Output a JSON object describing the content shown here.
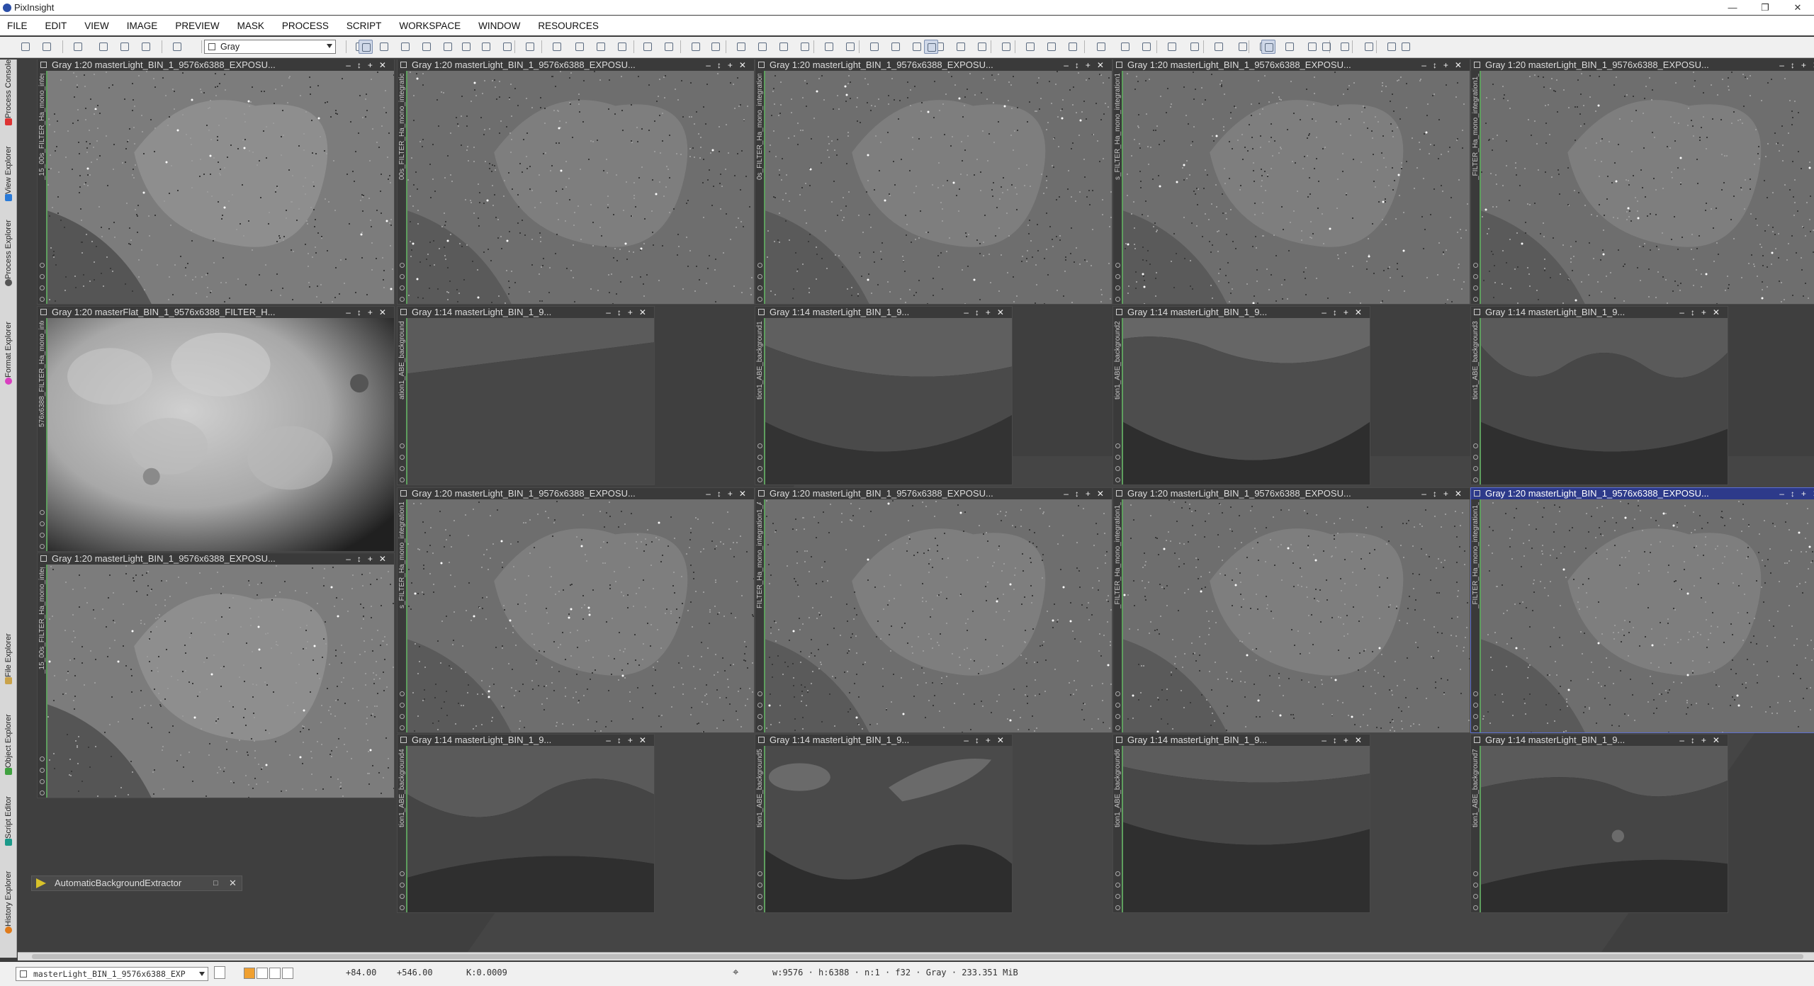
{
  "app": {
    "title": "PixInsight"
  },
  "menu": [
    "FILE",
    "EDIT",
    "VIEW",
    "IMAGE",
    "PREVIEW",
    "MASK",
    "PROCESS",
    "SCRIPT",
    "WORKSPACE",
    "WINDOW",
    "RESOURCES"
  ],
  "toolbar": {
    "view_selector": "Gray"
  },
  "left_tabs": [
    "Process Console",
    "View Explorer",
    "Process Explorer",
    "Format Explorer",
    "File Explorer",
    "Object Explorer",
    "Script Editor",
    "History Explorer"
  ],
  "windows": [
    {
      "title": "Gray 1:20 masterLight_BIN_1_9576x6388_EXPOSU...",
      "side": "_15_00s_FILTER_Ha_mono_integration1",
      "kind": "nebula",
      "active": false
    },
    {
      "title": "Gray 1:20 masterLight_BIN_1_9576x6388_EXPOSU...",
      "side": "00s_FILTER_Ha_mono_integration1_ABE",
      "kind": "nebula",
      "active": false
    },
    {
      "title": "Gray 1:20 masterLight_BIN_1_9576x6388_EXPOSU...",
      "side": "0s_FILTER_Ha_mono_integration1_ABE1",
      "kind": "nebula",
      "active": false
    },
    {
      "title": "Gray 1:20 masterLight_BIN_1_9576x6388_EXPOSU...",
      "side": "s_FILTER_Ha_mono_integration1_ABE2",
      "kind": "nebula",
      "active": false
    },
    {
      "title": "Gray 1:20 masterLight_BIN_1_9576x6388_EXPOSU...",
      "side": "_FILTER_Ha_mono_integration1_ABE3",
      "kind": "nebula",
      "active": false
    },
    {
      "title": "Gray 1:20 masterFlat_BIN_1_9576x6388_FILTER_H...",
      "side": "576x6388_FILTER_Ha_mono_integration",
      "kind": "flat",
      "active": false
    },
    {
      "title": "Gray 1:20 masterLight_BIN_1_9576x6388_EXPOSU...",
      "side": "_15_00s_FILTER_Ha_mono_integration",
      "kind": "nebula",
      "active": false
    },
    {
      "title": "Gray 1:14 masterLight_BIN_1_9...",
      "side": "ation1_ABE_background",
      "kind": "bg",
      "active": false
    },
    {
      "title": "Gray 1:14 masterLight_BIN_1_9...",
      "side": "tion1_ABE_background1",
      "kind": "bg",
      "active": false
    },
    {
      "title": "Gray 1:14 masterLight_BIN_1_9...",
      "side": "tion1_ABE_background2",
      "kind": "bg",
      "active": false
    },
    {
      "title": "Gray 1:14 masterLight_BIN_1_9...",
      "side": "tion1_ABE_background3",
      "kind": "bg",
      "active": false
    },
    {
      "title": "Gray 1:20 masterLight_BIN_1_9576x6388_EXPOSU...",
      "side": "s_FILTER_Ha_mono_integration1_ABE4",
      "kind": "nebula",
      "active": false
    },
    {
      "title": "Gray 1:20 masterLight_BIN_1_9576x6388_EXPOSU...",
      "side": "FILTER_Ha_mono_integration1_ABE5",
      "kind": "nebula",
      "active": false
    },
    {
      "title": "Gray 1:20 masterLight_BIN_1_9576x6388_EXPOSU...",
      "side": "_FILTER_Ha_mono_integration1_ABE6",
      "kind": "nebula",
      "active": false
    },
    {
      "title": "Gray 1:20 masterLight_BIN_1_9576x6388_EXPOSU...",
      "side": "_FILTER_Ha_mono_integration1_ABE7",
      "kind": "nebula",
      "active": true
    },
    {
      "title": "Gray 1:14 masterLight_BIN_1_9...",
      "side": "tion1_ABE_background4",
      "kind": "bg",
      "active": false
    },
    {
      "title": "Gray 1:14 masterLight_BIN_1_9...",
      "side": "tion1_ABE_background5",
      "kind": "bg",
      "active": false
    },
    {
      "title": "Gray 1:14 masterLight_BIN_1_9...",
      "side": "tion1_ABE_background6",
      "kind": "bg",
      "active": false
    },
    {
      "title": "Gray 1:14 masterLight_BIN_1_9...",
      "side": "tion1_ABE_background7",
      "kind": "bg",
      "active": false
    }
  ],
  "process_icon": {
    "label": "AutomaticBackgroundExtractor"
  },
  "status": {
    "view": "masterLight_BIN_1_9576x6388_EXP",
    "x": "+84.00",
    "y": "+546.00",
    "k": "K:0.0009",
    "info": "w:9576 · h:6388 · n:1 · f32 · Gray · 233.351 MiB"
  }
}
